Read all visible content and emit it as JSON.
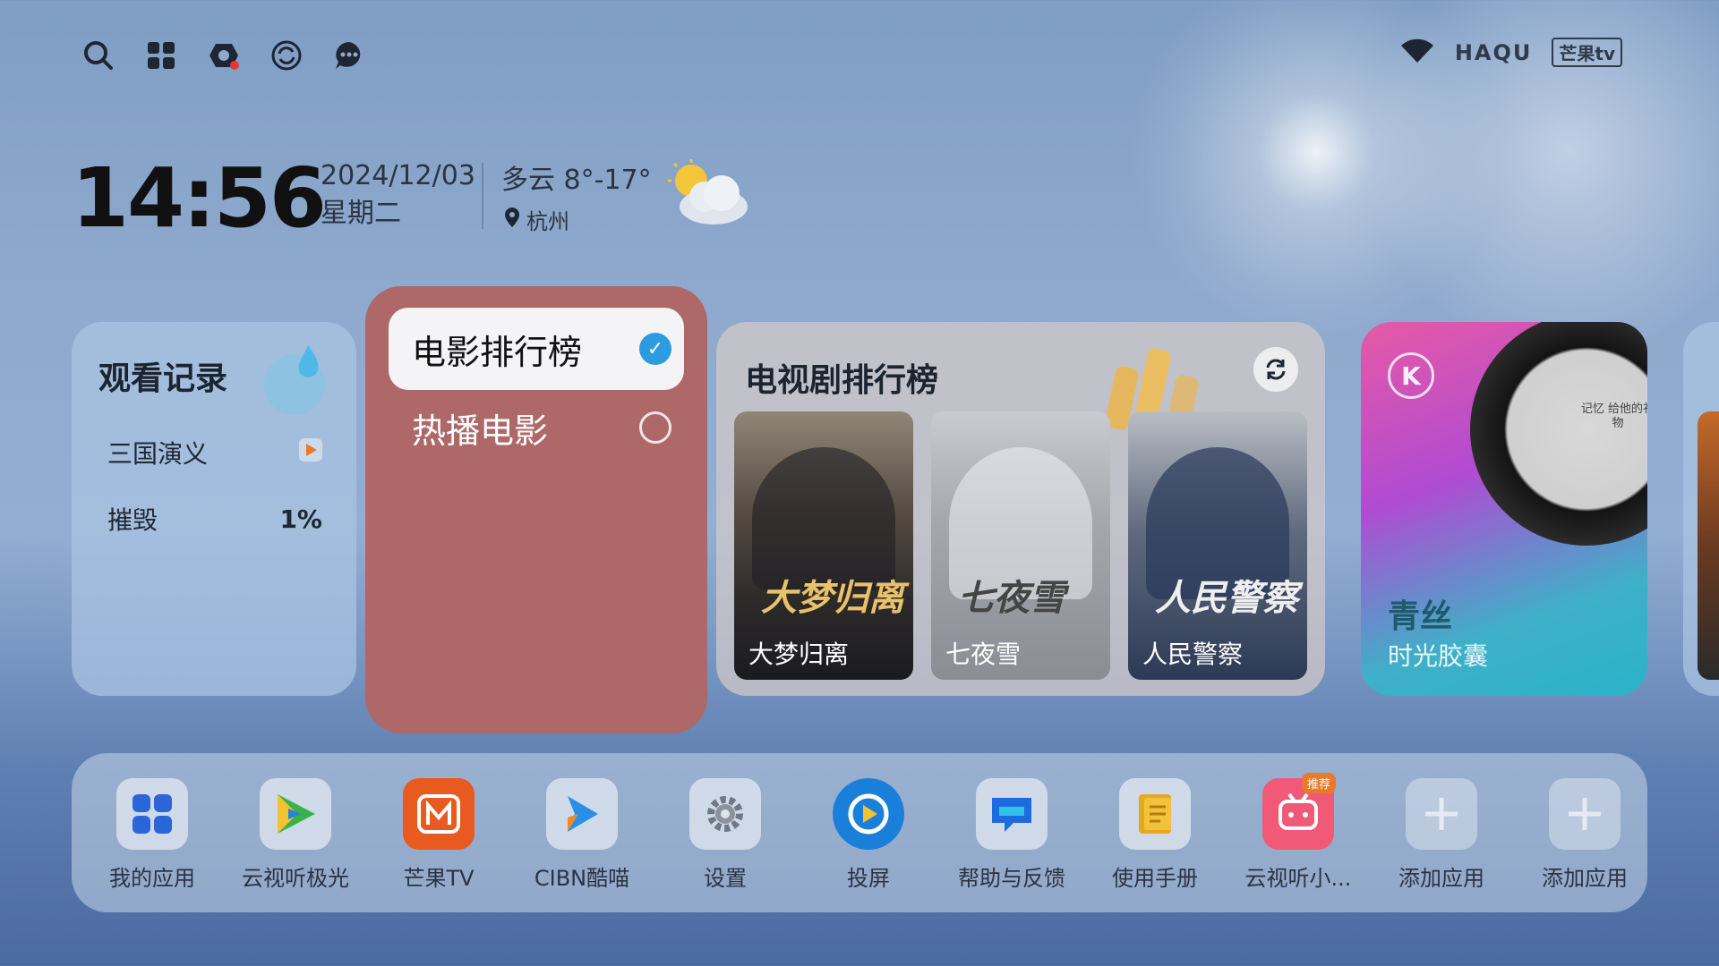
{
  "status_bar": {
    "icons": [
      "search-icon",
      "apps-grid-icon",
      "notification-icon",
      "sync-icon",
      "chat-icon"
    ],
    "wifi_icon": "wifi-icon",
    "brand": "HAQU",
    "partner_brand": "芒果tv"
  },
  "clock": {
    "time": "14:56",
    "date": "2024/12/03",
    "weekday": "星期二"
  },
  "weather": {
    "summary": "多云 8°-17°",
    "location": "杭州",
    "icon": "partly-cloudy-icon"
  },
  "watch_history": {
    "title": "观看记录",
    "items": [
      {
        "name": "三国演义",
        "status_icon": "play-icon"
      },
      {
        "name": "摧毁",
        "progress_text": "1%"
      }
    ]
  },
  "movie_menu": {
    "options": [
      {
        "label": "电影排行榜",
        "selected": true
      },
      {
        "label": "热播电影",
        "selected": false
      }
    ]
  },
  "tv_ranking": {
    "title": "电视剧排行榜",
    "posters": [
      {
        "title": "大梦归离",
        "art_text": "大梦归离"
      },
      {
        "title": "七夜雪",
        "art_text": "七夜雪"
      },
      {
        "title": "人民警察",
        "art_text": "人民警察"
      }
    ]
  },
  "music_card": {
    "title": "青丝",
    "subtitle": "时光胶囊",
    "logo": "K",
    "album_text": "记忆 给他的礼物"
  },
  "dock": {
    "apps": [
      {
        "label": "我的应用",
        "icon": "my-apps-icon",
        "color": "#2a66d8"
      },
      {
        "label": "云视听极光",
        "icon": "play-triangle-icon",
        "color": "#38b24a"
      },
      {
        "label": "芒果TV",
        "icon": "mango-tv-icon",
        "color": "#e85a1f"
      },
      {
        "label": "CIBN酷喵",
        "icon": "cibn-icon",
        "color": "#2a8fe8"
      },
      {
        "label": "设置",
        "icon": "gear-icon",
        "color": "#9aa3ad"
      },
      {
        "label": "投屏",
        "icon": "cast-icon",
        "color": "#1a7fd8"
      },
      {
        "label": "帮助与反馈",
        "icon": "help-chat-icon",
        "color": "#1e6ae0"
      },
      {
        "label": "使用手册",
        "icon": "manual-icon",
        "color": "#e6a820"
      },
      {
        "label": "云视听小...",
        "icon": "bilibili-tv-icon",
        "color": "#f05a78",
        "badge": "推荐"
      },
      {
        "label": "添加应用",
        "icon": "add-icon",
        "color": "#d6dde8"
      },
      {
        "label": "添加应用",
        "icon": "add-icon",
        "color": "#d6dde8"
      }
    ]
  }
}
